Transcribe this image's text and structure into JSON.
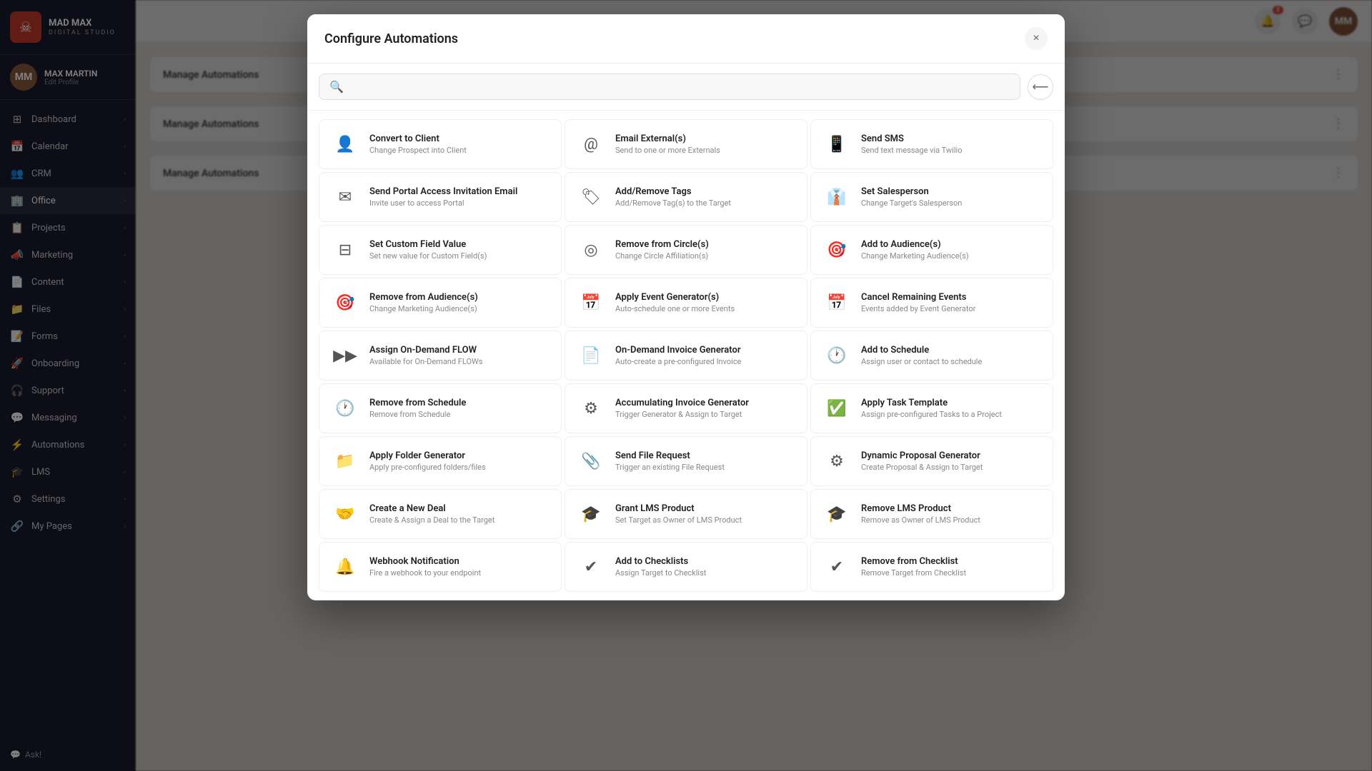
{
  "app": {
    "name": "MAD MAX",
    "subtitle": "digital studio",
    "logo_symbol": "☠"
  },
  "user": {
    "name": "MAX MARTIN",
    "edit_label": "Edit Profile",
    "initials": "MM"
  },
  "sidebar": {
    "items": [
      {
        "id": "dashboard",
        "label": "Dashboard",
        "icon": "⊞",
        "has_arrow": true
      },
      {
        "id": "calendar",
        "label": "Calendar",
        "icon": "📅",
        "has_arrow": true
      },
      {
        "id": "crm",
        "label": "CRM",
        "icon": "👥",
        "has_arrow": true
      },
      {
        "id": "office",
        "label": "Office",
        "icon": "🏢",
        "has_arrow": true,
        "active": true
      },
      {
        "id": "projects",
        "label": "Projects",
        "icon": "📋",
        "has_arrow": true
      },
      {
        "id": "marketing",
        "label": "Marketing",
        "icon": "📣",
        "has_arrow": true
      },
      {
        "id": "content",
        "label": "Content",
        "icon": "📄",
        "has_arrow": true
      },
      {
        "id": "files",
        "label": "Files",
        "icon": "📁",
        "has_arrow": true
      },
      {
        "id": "forms",
        "label": "Forms",
        "icon": "📝",
        "has_arrow": true
      },
      {
        "id": "onboarding",
        "label": "Onboarding",
        "icon": "🚀",
        "has_arrow": true
      },
      {
        "id": "support",
        "label": "Support",
        "icon": "🎧",
        "has_arrow": true
      },
      {
        "id": "messaging",
        "label": "Messaging",
        "icon": "💬",
        "has_arrow": true
      },
      {
        "id": "automations",
        "label": "Automations",
        "icon": "⚡",
        "has_arrow": true
      },
      {
        "id": "lms",
        "label": "LMS",
        "icon": "🎓",
        "has_arrow": true
      },
      {
        "id": "settings",
        "label": "Settings",
        "icon": "⚙",
        "has_arrow": true
      },
      {
        "id": "mypages",
        "label": "My Pages",
        "icon": "🔗",
        "has_arrow": true
      }
    ],
    "ask_label": "Ask!"
  },
  "modal": {
    "title": "Configure Automations",
    "close_label": "×",
    "back_label": "←",
    "search_placeholder": "",
    "automations": [
      {
        "id": "convert-to-client",
        "title": "Convert to Client",
        "desc": "Change Prospect into Client",
        "icon": "👤"
      },
      {
        "id": "email-externals",
        "title": "Email External(s)",
        "desc": "Send to one or more Externals",
        "icon": "@"
      },
      {
        "id": "send-sms",
        "title": "Send SMS",
        "desc": "Send text message via Twilio",
        "icon": "💬"
      },
      {
        "id": "send-portal-access",
        "title": "Send Portal Access Invitation Email",
        "desc": "Invite user to access Portal",
        "icon": "✉"
      },
      {
        "id": "add-remove-tags",
        "title": "Add/Remove Tags",
        "desc": "Add/Remove Tag(s) to the Target",
        "icon": "🏷"
      },
      {
        "id": "set-salesperson",
        "title": "Set Salesperson",
        "desc": "Change Target's Salesperson",
        "icon": "⚙"
      },
      {
        "id": "set-custom-field",
        "title": "Set Custom Field Value",
        "desc": "Set new value for Custom Field(s)",
        "icon": "🔢"
      },
      {
        "id": "remove-from-circles",
        "title": "Remove from Circle(s)",
        "desc": "Change Circle Affiliation(s)",
        "icon": "◎"
      },
      {
        "id": "add-to-audiences",
        "title": "Add to Audience(s)",
        "desc": "Change Marketing Audience(s)",
        "icon": "🎯"
      },
      {
        "id": "remove-from-audiences",
        "title": "Remove from Audience(s)",
        "desc": "Change Marketing Audience(s)",
        "icon": "🎯"
      },
      {
        "id": "apply-event-generator",
        "title": "Apply Event Generator(s)",
        "desc": "Auto-schedule one or more Events",
        "icon": "📅"
      },
      {
        "id": "cancel-remaining-events",
        "title": "Cancel Remaining Events",
        "desc": "Events added by Event Generator",
        "icon": "📅"
      },
      {
        "id": "assign-on-demand-flow",
        "title": "Assign On-Demand FLOW",
        "desc": "Available for On-Demand FLOWs",
        "icon": "▶▶"
      },
      {
        "id": "on-demand-invoice-generator",
        "title": "On-Demand Invoice Generator",
        "desc": "Auto-create a pre-configured Invoice",
        "icon": "📄"
      },
      {
        "id": "add-to-schedule",
        "title": "Add to Schedule",
        "desc": "Assign user or contact to schedule",
        "icon": "🕐"
      },
      {
        "id": "remove-from-schedule",
        "title": "Remove from Schedule",
        "desc": "Remove from Schedule",
        "icon": "🕐"
      },
      {
        "id": "accumulating-invoice-generator",
        "title": "Accumulating Invoice Generator",
        "desc": "Trigger Generator & Assign to Target",
        "icon": "⚙"
      },
      {
        "id": "apply-task-template",
        "title": "Apply Task Template",
        "desc": "Assign pre-configured Tasks to a Project",
        "icon": "✅"
      },
      {
        "id": "apply-folder-generator",
        "title": "Apply Folder Generator",
        "desc": "Apply pre-configured folders/files",
        "icon": "📁"
      },
      {
        "id": "send-file-request",
        "title": "Send File Request",
        "desc": "Trigger an existing File Request",
        "icon": "📎"
      },
      {
        "id": "dynamic-proposal-generator",
        "title": "Dynamic Proposal Generator",
        "desc": "Create Proposal & Assign to Target",
        "icon": "⚙"
      },
      {
        "id": "create-new-deal",
        "title": "Create a New Deal",
        "desc": "Create & Assign a Deal to the Target",
        "icon": "🤝"
      },
      {
        "id": "grant-lms-product",
        "title": "Grant LMS Product",
        "desc": "Set Target as Owner of LMS Product",
        "icon": "🎓"
      },
      {
        "id": "remove-lms-product",
        "title": "Remove LMS Product",
        "desc": "Remove as Owner of LMS Product",
        "icon": "🎓"
      },
      {
        "id": "webhook-notification",
        "title": "Webhook Notification",
        "desc": "Fire a webhook to your endpoint",
        "icon": "🔔"
      },
      {
        "id": "add-to-checklists",
        "title": "Add to Checklists",
        "desc": "Assign Target to Checklist",
        "icon": "✔"
      },
      {
        "id": "remove-from-checklist",
        "title": "Remove from Checklist",
        "desc": "Remove Target from Checklist",
        "icon": "✔"
      }
    ]
  },
  "icons": {
    "convert_to_client": "👤",
    "email": "@",
    "sms": "💬",
    "portal": "✉",
    "tags": "🏷",
    "salesperson": "👔",
    "field": "⊟",
    "circle": "◎",
    "audience_add": "🎯",
    "audience_remove": "🎯",
    "event": "📅",
    "cancel_event": "📅",
    "flow": "▶",
    "invoice": "📄",
    "schedule_add": "🕐",
    "schedule_remove": "🕐",
    "accumulating": "⚙",
    "task": "✅",
    "folder": "📁",
    "file": "📎",
    "proposal": "⚙",
    "deal": "🤝",
    "lms_grant": "🎓",
    "lms_remove": "🎓",
    "webhook": "🔔",
    "checklist_add": "✔",
    "checklist_remove": "✔"
  }
}
